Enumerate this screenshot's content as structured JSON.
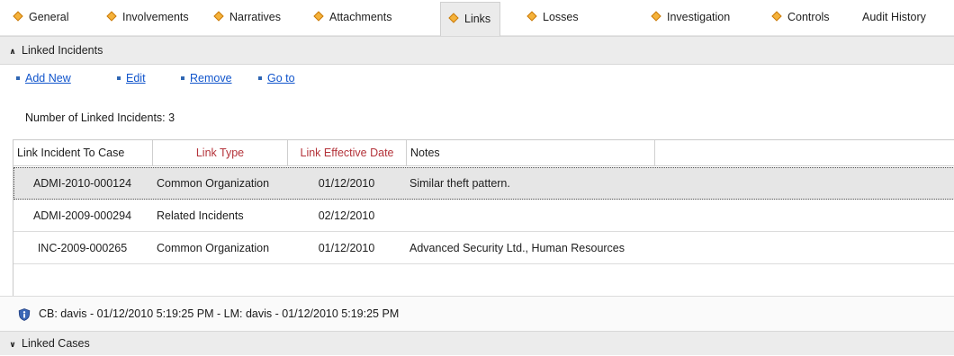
{
  "tabs": [
    {
      "label": "General",
      "icon": "diamond-icon"
    },
    {
      "label": "Involvements",
      "icon": "diamond-icon"
    },
    {
      "label": "Narratives",
      "icon": "diamond-icon"
    },
    {
      "label": "Attachments",
      "icon": "diamond-icon"
    },
    {
      "label": "Links",
      "icon": "diamond-icon",
      "active": true
    },
    {
      "label": "Losses",
      "icon": "diamond-icon"
    },
    {
      "label": "Investigation",
      "icon": "diamond-icon"
    },
    {
      "label": "Controls",
      "icon": "diamond-icon"
    },
    {
      "label": "Audit History"
    }
  ],
  "linked_incidents": {
    "title": "Linked Incidents",
    "collapse_icon": "chevron-up-double-icon",
    "toolbar": [
      {
        "label": "Add New"
      },
      {
        "label": "Edit"
      },
      {
        "label": "Remove"
      },
      {
        "label": "Go to"
      }
    ],
    "count_label": "Number of Linked Incidents: 3",
    "columns": [
      "Link Incident To Case",
      "Link Type",
      "Link Effective Date",
      "Notes"
    ],
    "rows": [
      {
        "case": "ADMI-2010-000124",
        "type": "Common Organization",
        "date": "01/12/2010",
        "notes": "Similar theft pattern.",
        "selected": true
      },
      {
        "case": "ADMI-2009-000294",
        "type": "Related Incidents",
        "date": "02/12/2010",
        "notes": ""
      },
      {
        "case": "INC-2009-000265",
        "type": "Common Organization",
        "date": "01/12/2010",
        "notes": "Advanced Security Ltd., Human Resources"
      }
    ],
    "audit_text": "CB: davis - 01/12/2010 5:19:25 PM - LM: davis - 01/12/2010 5:19:25 PM",
    "audit_icon": "shield-icon"
  },
  "linked_cases": {
    "title": "Linked Cases",
    "expand_icon": "chevron-down-double-icon"
  },
  "colors": {
    "tab_diamond": "#f5b23a",
    "link": "#1155cc",
    "required_header": "#b4333a",
    "section_bg": "#ececec",
    "selected_row_bg": "#e6e6e6"
  }
}
